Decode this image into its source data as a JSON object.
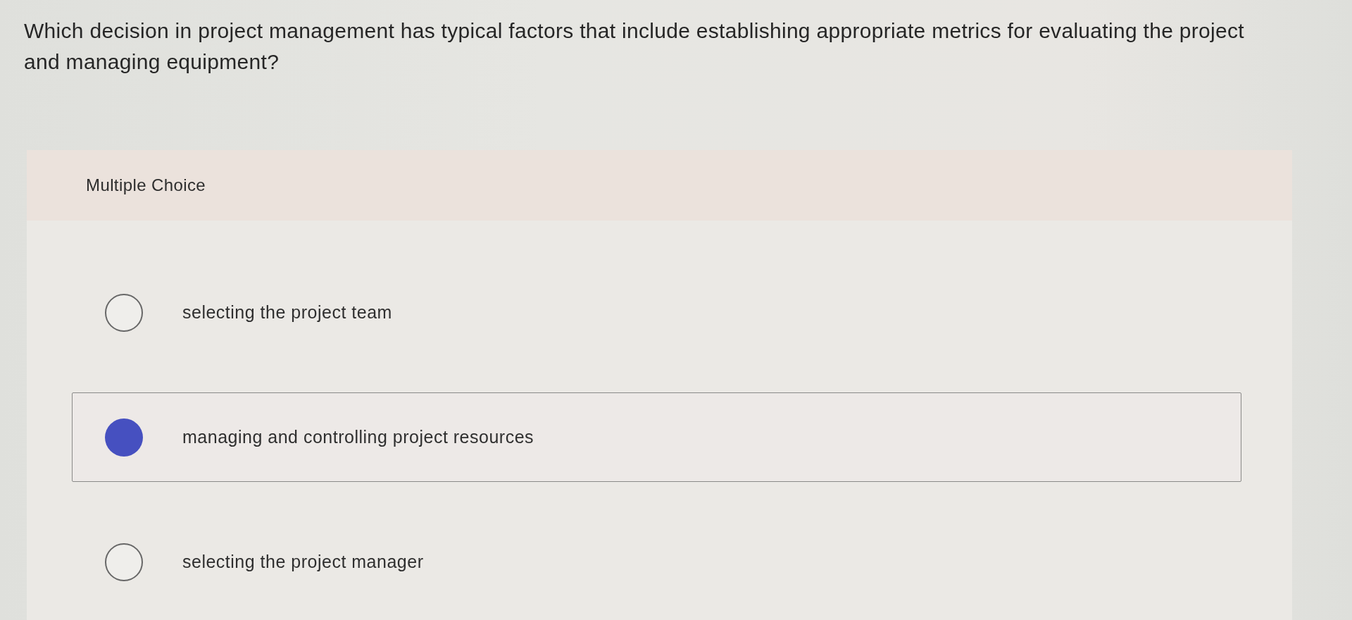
{
  "question": "Which decision in project management has typical factors that include establishing appropriate metrics for evaluating the project and managing equipment?",
  "card": {
    "label": "Multiple Choice"
  },
  "options": [
    {
      "text": "selecting the project team",
      "selected": false
    },
    {
      "text": "managing and controlling project resources",
      "selected": true
    },
    {
      "text": "selecting the project manager",
      "selected": false
    }
  ]
}
